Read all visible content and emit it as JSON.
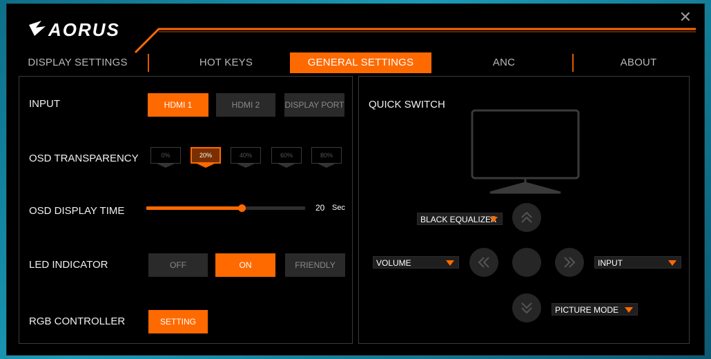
{
  "app": {
    "brand": "AORUS"
  },
  "tabs": [
    {
      "label": "DISPLAY SETTINGS",
      "active": false
    },
    {
      "label": "HOT KEYS",
      "active": false
    },
    {
      "label": "GENERAL SETTINGS",
      "active": true
    },
    {
      "label": "ANC",
      "active": false
    },
    {
      "label": "ABOUT",
      "active": false
    }
  ],
  "general": {
    "input": {
      "label": "INPUT",
      "options": [
        "HDMI 1",
        "HDMI 2",
        "DISPLAY PORT"
      ],
      "selected": "HDMI 1"
    },
    "osd_transparency": {
      "label": "OSD TRANSPARENCY",
      "options": [
        "0%",
        "20%",
        "40%",
        "60%",
        "80%"
      ],
      "selected": "20%"
    },
    "osd_display_time": {
      "label": "OSD DISPLAY TIME",
      "value": "20",
      "unit": "Sec",
      "fraction": 0.6
    },
    "led_indicator": {
      "label": "LED INDICATOR",
      "options": [
        "OFF",
        "ON",
        "FRIENDLY"
      ],
      "selected": "ON"
    },
    "rgb_controller": {
      "label": "RGB CONTROLLER",
      "button": "SETTING"
    }
  },
  "quick_switch": {
    "title": "QUICK SWITCH",
    "up": "BLACK EQUALIZER",
    "left": "VOLUME",
    "right": "INPUT",
    "down": "PICTURE MODE"
  },
  "colors": {
    "accent": "#ff6a00",
    "background": "#000000",
    "inactive": "#2a2a2a"
  },
  "icons": {
    "close": "close-icon",
    "up": "chevron-double-up-icon",
    "down": "chevron-double-down-icon",
    "left": "chevron-double-left-icon",
    "right": "chevron-double-right-icon",
    "monitor": "monitor-icon"
  }
}
